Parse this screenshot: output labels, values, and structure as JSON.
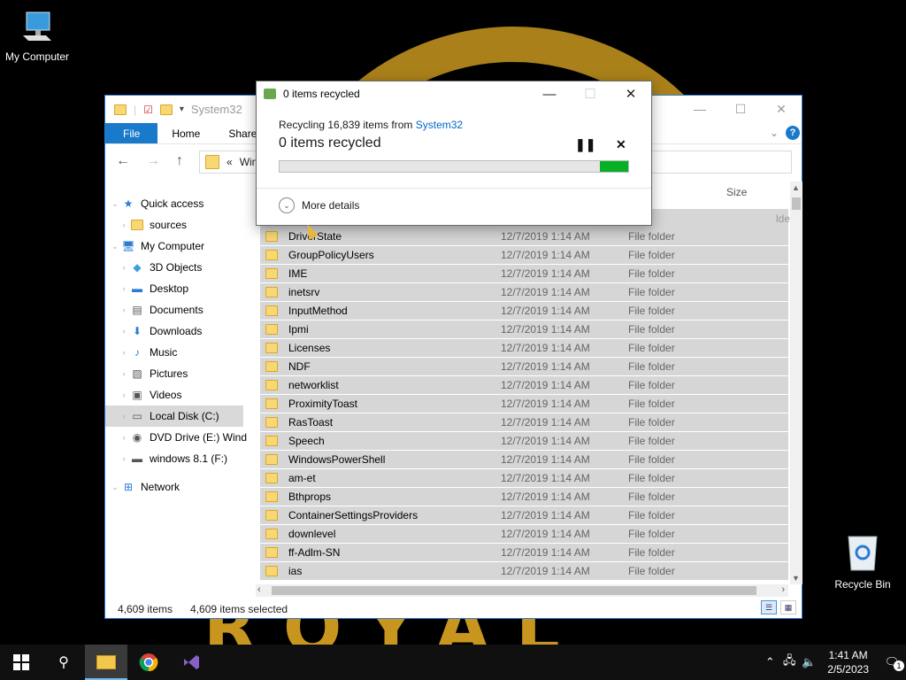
{
  "desktop": {
    "icons": [
      {
        "label": "My Computer"
      },
      {
        "label": "Recycle Bin"
      }
    ],
    "wallpaper_text": "ROYAL"
  },
  "explorer": {
    "title": "System32",
    "ribbon_tabs": [
      "File",
      "Home",
      "Share"
    ],
    "help_label": "?",
    "address_prefix": "«",
    "address_text": "Wind",
    "column_size": "Size",
    "sidebar": [
      {
        "label": "Quick access",
        "icon": "star-icon",
        "indent": 0
      },
      {
        "label": "sources",
        "icon": "folder-icon",
        "indent": 1
      },
      {
        "label": "My Computer",
        "icon": "computer-icon",
        "indent": 0
      },
      {
        "label": "3D Objects",
        "icon": "cube-icon",
        "indent": 1
      },
      {
        "label": "Desktop",
        "icon": "desktop-icon",
        "indent": 1
      },
      {
        "label": "Documents",
        "icon": "document-icon",
        "indent": 1
      },
      {
        "label": "Downloads",
        "icon": "download-icon",
        "indent": 1
      },
      {
        "label": "Music",
        "icon": "music-icon",
        "indent": 1
      },
      {
        "label": "Pictures",
        "icon": "picture-icon",
        "indent": 1
      },
      {
        "label": "Videos",
        "icon": "video-icon",
        "indent": 1
      },
      {
        "label": "Local Disk (C:)",
        "icon": "disk-icon",
        "indent": 1
      },
      {
        "label": "DVD Drive (E:) Wind",
        "icon": "dvd-icon",
        "indent": 1
      },
      {
        "label": "windows 8.1 (F:)",
        "icon": "usb-drive-icon",
        "indent": 1
      },
      {
        "label": "Network",
        "icon": "network-icon",
        "indent": 0
      }
    ],
    "partial_row_type": "lder",
    "rows": [
      {
        "name": "DriverState",
        "date": "12/7/2019 1:14 AM",
        "type": "File folder"
      },
      {
        "name": "GroupPolicyUsers",
        "date": "12/7/2019 1:14 AM",
        "type": "File folder"
      },
      {
        "name": "IME",
        "date": "12/7/2019 1:14 AM",
        "type": "File folder"
      },
      {
        "name": "inetsrv",
        "date": "12/7/2019 1:14 AM",
        "type": "File folder"
      },
      {
        "name": "InputMethod",
        "date": "12/7/2019 1:14 AM",
        "type": "File folder"
      },
      {
        "name": "Ipmi",
        "date": "12/7/2019 1:14 AM",
        "type": "File folder"
      },
      {
        "name": "Licenses",
        "date": "12/7/2019 1:14 AM",
        "type": "File folder"
      },
      {
        "name": "NDF",
        "date": "12/7/2019 1:14 AM",
        "type": "File folder"
      },
      {
        "name": "networklist",
        "date": "12/7/2019 1:14 AM",
        "type": "File folder"
      },
      {
        "name": "ProximityToast",
        "date": "12/7/2019 1:14 AM",
        "type": "File folder"
      },
      {
        "name": "RasToast",
        "date": "12/7/2019 1:14 AM",
        "type": "File folder"
      },
      {
        "name": "Speech",
        "date": "12/7/2019 1:14 AM",
        "type": "File folder"
      },
      {
        "name": "WindowsPowerShell",
        "date": "12/7/2019 1:14 AM",
        "type": "File folder"
      },
      {
        "name": "am-et",
        "date": "12/7/2019 1:14 AM",
        "type": "File folder"
      },
      {
        "name": "Bthprops",
        "date": "12/7/2019 1:14 AM",
        "type": "File folder"
      },
      {
        "name": "ContainerSettingsProviders",
        "date": "12/7/2019 1:14 AM",
        "type": "File folder"
      },
      {
        "name": "downlevel",
        "date": "12/7/2019 1:14 AM",
        "type": "File folder"
      },
      {
        "name": "ff-Adlm-SN",
        "date": "12/7/2019 1:14 AM",
        "type": "File folder"
      },
      {
        "name": "ias",
        "date": "12/7/2019 1:14 AM",
        "type": "File folder"
      }
    ],
    "status_count": "4,609 items",
    "status_selected": "4,609 items selected"
  },
  "dialog": {
    "title": "0 items recycled",
    "from_prefix": "Recycling 16,839 items from ",
    "from_link": "System32",
    "headline": "0 items recycled",
    "progress_fraction": 0.08,
    "more_details": "More details"
  },
  "taskbar": {
    "time": "1:41 AM",
    "date": "2/5/2023",
    "notif_count": "1"
  }
}
